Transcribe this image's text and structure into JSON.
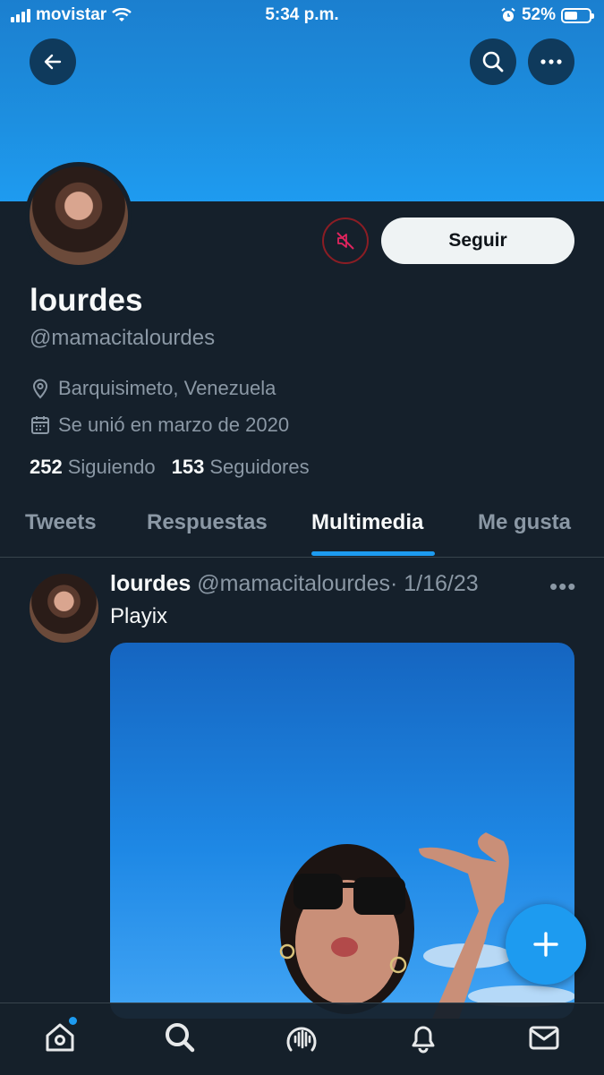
{
  "status_bar": {
    "carrier": "movistar",
    "time": "5:34 p.m.",
    "battery": "52%",
    "battery_level": 0.52
  },
  "header": {
    "back_icon": "arrow-left-icon",
    "search_icon": "search-icon",
    "more_icon": "more-horizontal-icon"
  },
  "profile": {
    "name": "lourdes",
    "handle": "@mamacitalourdes",
    "location": "Barquisimeto, Venezuela",
    "joined": "Se unió en marzo de 2020",
    "following_count": "252",
    "following_label": "Siguiendo",
    "followers_count": "153",
    "followers_label": "Seguidores",
    "follow_button": "Seguir",
    "muted_icon": "muted-speaker-icon"
  },
  "tabs": [
    {
      "label": "Tweets"
    },
    {
      "label": "Respuestas"
    },
    {
      "label": "Multimedia"
    },
    {
      "label": "Me gusta"
    }
  ],
  "active_tab": "Multimedia",
  "tweet": {
    "name": "lourdes",
    "handle": "@mamacitalourdes",
    "date": "· 1/16/23",
    "text": "Playix",
    "more": "•••"
  },
  "fab": {
    "icon": "compose-plus-icon"
  },
  "bottom_nav": [
    {
      "icon": "home-icon",
      "has_dot": true
    },
    {
      "icon": "search-icon"
    },
    {
      "icon": "spaces-icon"
    },
    {
      "icon": "bell-icon"
    },
    {
      "icon": "mail-icon"
    }
  ],
  "colors": {
    "accent": "#1d9bf0",
    "background": "#15202b",
    "muted_border": "#8b1d24"
  }
}
